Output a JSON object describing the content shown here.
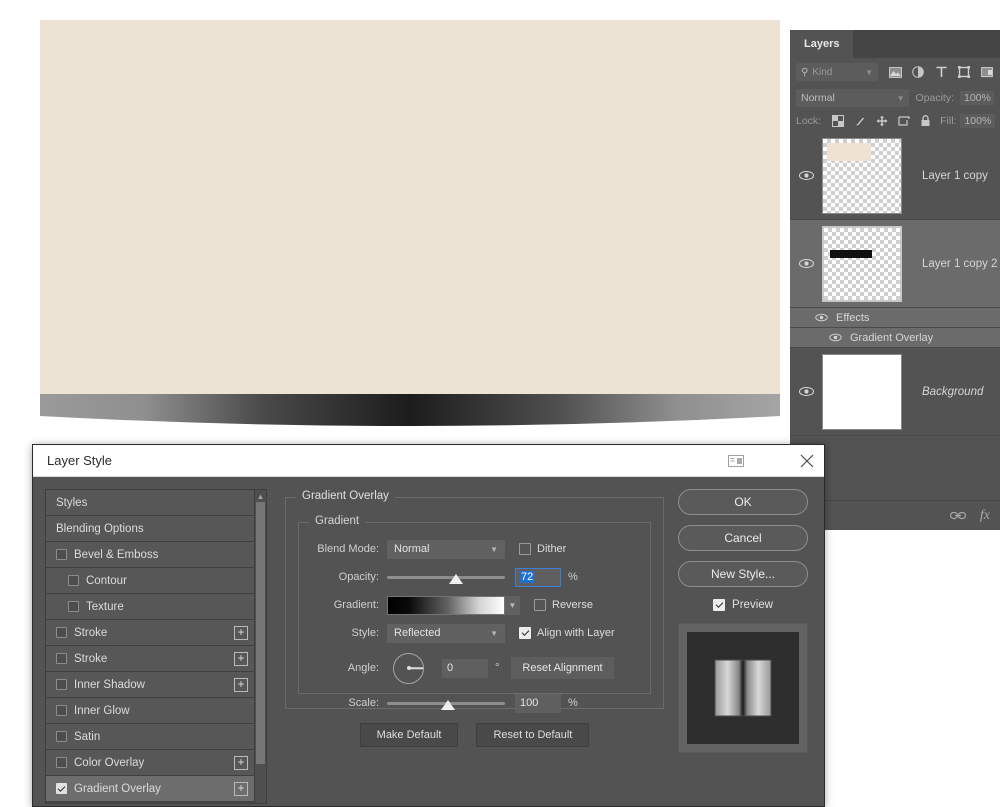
{
  "canvas": {
    "artboard_color": "#ece3d5",
    "shadow_description": "curved-gradient-shadow"
  },
  "layers_panel": {
    "tab_label": "Layers",
    "filter": {
      "kind_label": "Kind",
      "search_icon": "search-icon",
      "icons": [
        "pixel-layer-icon",
        "adjustment-layer-icon",
        "type-layer-icon",
        "shape-layer-icon",
        "smart-object-icon"
      ]
    },
    "blend_mode": "Normal",
    "opacity_label": "Opacity:",
    "opacity_value": "100%",
    "lock_label": "Lock:",
    "lock_icons": [
      "lock-transparent-pixels-icon",
      "lock-image-pixels-icon",
      "lock-position-icon",
      "lock-artboard-icon",
      "lock-all-icon"
    ],
    "fill_label": "Fill:",
    "fill_value": "100%",
    "layers": [
      {
        "name": "Layer 1 copy",
        "visible": true,
        "selected": false,
        "thumb": "cream-rect",
        "italic": false
      },
      {
        "name": "Layer 1 copy 2",
        "visible": true,
        "selected": true,
        "thumb": "black-bar",
        "italic": false
      }
    ],
    "effects": {
      "label": "Effects",
      "items": [
        "Gradient Overlay"
      ]
    },
    "background_layer": {
      "name": "Background",
      "visible": true,
      "italic": true,
      "thumb": "white"
    },
    "footer_icons": [
      "link-layers-icon",
      "add-layer-style-fx-icon"
    ]
  },
  "dialog": {
    "title": "Layer Style",
    "dock_icon": "dock-panel-icon",
    "close_icon": "close-icon",
    "styles_list": [
      {
        "label": "Styles",
        "type": "header",
        "checkbox": false,
        "plus": false,
        "indent": 0,
        "active": false
      },
      {
        "label": "Blending Options",
        "type": "header",
        "checkbox": false,
        "plus": false,
        "indent": 0,
        "active": false
      },
      {
        "label": "Bevel & Emboss",
        "type": "effect",
        "checkbox": true,
        "checked": false,
        "plus": false,
        "indent": 0,
        "active": false
      },
      {
        "label": "Contour",
        "type": "effect",
        "checkbox": true,
        "checked": false,
        "plus": false,
        "indent": 1,
        "active": false
      },
      {
        "label": "Texture",
        "type": "effect",
        "checkbox": true,
        "checked": false,
        "plus": false,
        "indent": 1,
        "active": false
      },
      {
        "label": "Stroke",
        "type": "effect",
        "checkbox": true,
        "checked": false,
        "plus": true,
        "indent": 0,
        "active": false
      },
      {
        "label": "Stroke",
        "type": "effect",
        "checkbox": true,
        "checked": false,
        "plus": true,
        "indent": 0,
        "active": false
      },
      {
        "label": "Inner Shadow",
        "type": "effect",
        "checkbox": true,
        "checked": false,
        "plus": true,
        "indent": 0,
        "active": false
      },
      {
        "label": "Inner Glow",
        "type": "effect",
        "checkbox": true,
        "checked": false,
        "plus": false,
        "indent": 0,
        "active": false
      },
      {
        "label": "Satin",
        "type": "effect",
        "checkbox": true,
        "checked": false,
        "plus": false,
        "indent": 0,
        "active": false
      },
      {
        "label": "Color Overlay",
        "type": "effect",
        "checkbox": true,
        "checked": false,
        "plus": true,
        "indent": 0,
        "active": false
      },
      {
        "label": "Gradient Overlay",
        "type": "effect",
        "checkbox": true,
        "checked": true,
        "plus": true,
        "indent": 0,
        "active": true
      }
    ],
    "scrollbar": {
      "up_arrow": "chevron-up-icon"
    },
    "section": {
      "title": "Gradient Overlay",
      "inner_title": "Gradient",
      "blend_mode_label": "Blend Mode:",
      "blend_mode_value": "Normal",
      "dither_label": "Dither",
      "dither_checked": false,
      "opacity_label": "Opacity:",
      "opacity_value": "72",
      "opacity_unit": "%",
      "gradient_label": "Gradient:",
      "reverse_label": "Reverse",
      "reverse_checked": false,
      "style_label": "Style:",
      "style_value": "Reflected",
      "align_label": "Align with Layer",
      "align_checked": true,
      "angle_label": "Angle:",
      "angle_value": "0",
      "angle_unit": "°",
      "reset_alignment_label": "Reset Alignment",
      "scale_label": "Scale:",
      "scale_value": "100",
      "scale_unit": "%",
      "make_default_label": "Make Default",
      "reset_default_label": "Reset to Default"
    },
    "buttons": {
      "ok": "OK",
      "cancel": "Cancel",
      "new_style": "New Style...",
      "preview_label": "Preview",
      "preview_checked": true
    }
  },
  "colors": {
    "panel_bg": "#535353",
    "dialog_bg": "#535353",
    "accent_blue": "#1f6fd4",
    "artboard": "#ece3d5"
  }
}
